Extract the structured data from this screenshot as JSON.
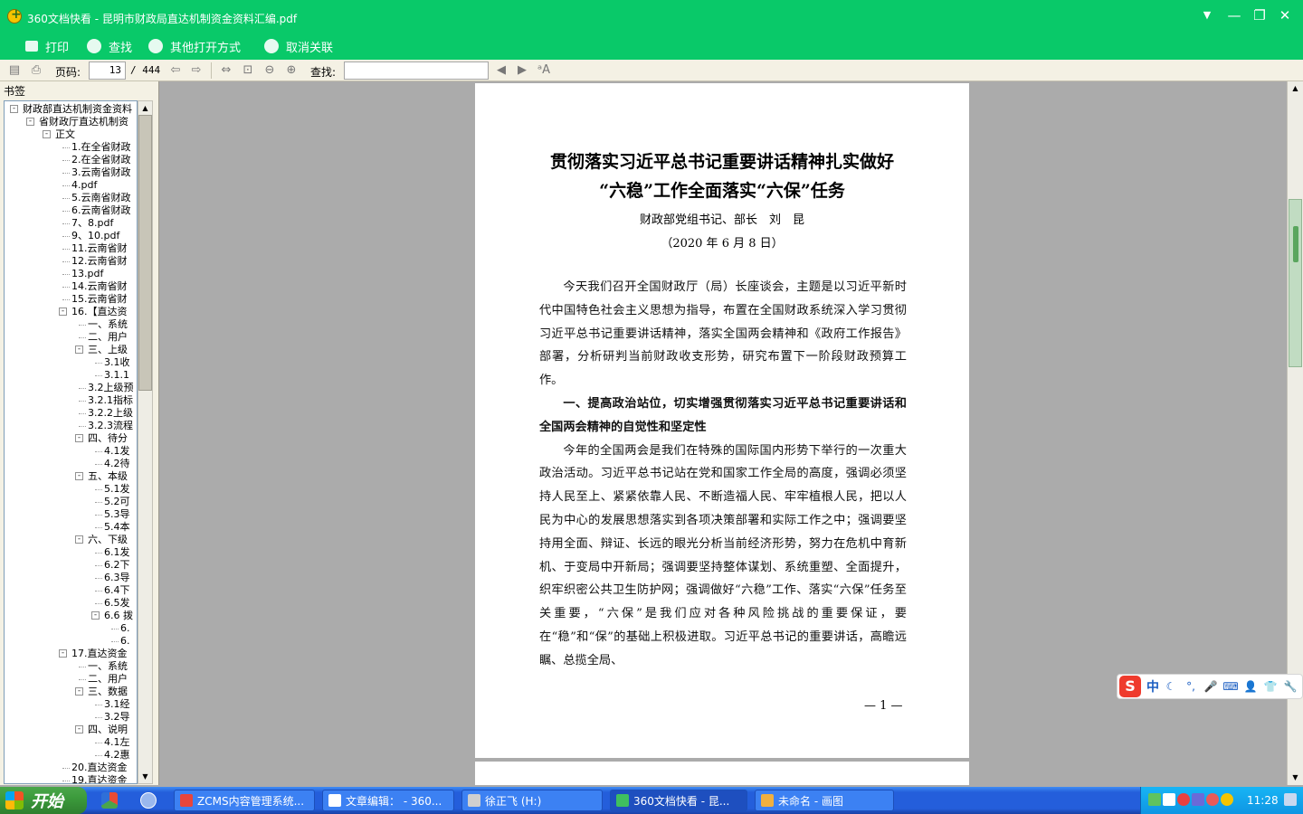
{
  "window": {
    "title": "360文档快看 - 昆明市财政局直达机制资金资料汇编.pdf",
    "minimize_glyph": "—",
    "maximize_glyph": "❐",
    "close_glyph": "✕",
    "menu_glyph": "▼"
  },
  "menu": {
    "print": "打印",
    "find": "查找",
    "open_with": "其他打开方式",
    "unassociate": "取消关联"
  },
  "toolbar": {
    "page_label": "页码:",
    "page_value": "13",
    "page_total": "/ 444",
    "search_label": "查找:",
    "search_value": ""
  },
  "sidebar": {
    "title": "书签",
    "items": [
      {
        "label": "财政部直达机制资金资料",
        "level": 0,
        "toggle": "-"
      },
      {
        "label": "省财政厅直达机制资",
        "level": 1,
        "toggle": "-"
      },
      {
        "label": "正文",
        "level": 2,
        "toggle": "-"
      },
      {
        "label": "1.在全省财政",
        "level": 3
      },
      {
        "label": "2.在全省财政",
        "level": 3
      },
      {
        "label": "3.云南省财政",
        "level": 3
      },
      {
        "label": "4.pdf",
        "level": 3
      },
      {
        "label": "5.云南省财政",
        "level": 3
      },
      {
        "label": "6.云南省财政",
        "level": 3
      },
      {
        "label": "7、8.pdf",
        "level": 3
      },
      {
        "label": "9、10.pdf",
        "level": 3
      },
      {
        "label": "11.云南省财",
        "level": 3
      },
      {
        "label": "12.云南省财",
        "level": 3
      },
      {
        "label": "13.pdf",
        "level": 3
      },
      {
        "label": "14.云南省财",
        "level": 3
      },
      {
        "label": "15.云南省财",
        "level": 3
      },
      {
        "label": "16.【直达资",
        "level": 3,
        "toggle": "-"
      },
      {
        "label": "一、系统",
        "level": 4
      },
      {
        "label": "二、用户",
        "level": 4
      },
      {
        "label": "三、上级",
        "level": 4,
        "toggle": "-"
      },
      {
        "label": "3.1收",
        "level": 5
      },
      {
        "label": "3.1.1",
        "level": 5
      },
      {
        "label": "3.2上级预",
        "level": 4
      },
      {
        "label": "3.2.1指标",
        "level": 4
      },
      {
        "label": "3.2.2上级",
        "level": 4
      },
      {
        "label": "3.2.3流程",
        "level": 4
      },
      {
        "label": "四、待分",
        "level": 4,
        "toggle": "-"
      },
      {
        "label": "4.1发",
        "level": 5
      },
      {
        "label": "4.2待",
        "level": 5
      },
      {
        "label": "五、本级",
        "level": 4,
        "toggle": "-"
      },
      {
        "label": "5.1发",
        "level": 5
      },
      {
        "label": "5.2可",
        "level": 5
      },
      {
        "label": "5.3导",
        "level": 5
      },
      {
        "label": "5.4本",
        "level": 5
      },
      {
        "label": "六、下级",
        "level": 4,
        "toggle": "-"
      },
      {
        "label": "6.1发",
        "level": 5
      },
      {
        "label": "6.2下",
        "level": 5
      },
      {
        "label": "6.3导",
        "level": 5
      },
      {
        "label": "6.4下",
        "level": 5
      },
      {
        "label": "6.5发",
        "level": 5
      },
      {
        "label": "6.6 拨",
        "level": 5,
        "toggle": "-"
      },
      {
        "label": "6.",
        "level": 6
      },
      {
        "label": "6.",
        "level": 6
      },
      {
        "label": "17.直达资金",
        "level": 3,
        "toggle": "-"
      },
      {
        "label": "一、系统",
        "level": 4
      },
      {
        "label": "二、用户",
        "level": 4
      },
      {
        "label": "三、数据",
        "level": 4,
        "toggle": "-"
      },
      {
        "label": "3.1经",
        "level": 5
      },
      {
        "label": "3.2导",
        "level": 5
      },
      {
        "label": "四、说明",
        "level": 4,
        "toggle": "-"
      },
      {
        "label": "4.1左",
        "level": 5
      },
      {
        "label": "4.2惠",
        "level": 5
      },
      {
        "label": "20.直达资金",
        "level": 3
      },
      {
        "label": "19.直达资金",
        "level": 3
      }
    ]
  },
  "document": {
    "title_line1": "贯彻落实习近平总书记重要讲话精神扎实做好",
    "title_line2": "“六稳”工作全面落实“六保”任务",
    "author": "财政部党组书记、部长　刘　昆",
    "date": "（2020 年 6 月 8 日）",
    "paragraphs": [
      {
        "type": "text",
        "text": "今天我们召开全国财政厅（局）长座谈会，主题是以习近平新时代中国特色社会主义思想为指导，布置在全国财政系统深入学习贯彻习近平总书记重要讲话精神，落实全国两会精神和《政府工作报告》部署，分析研判当前财政收支形势，研究布置下一阶段财政预算工作。"
      },
      {
        "type": "heading",
        "text": "一、提高政治站位，切实增强贯彻落实习近平总书记重要讲话和全国两会精神的自觉性和坚定性"
      },
      {
        "type": "text",
        "text": "今年的全国两会是我们在特殊的国际国内形势下举行的一次重大政治活动。习近平总书记站在党和国家工作全局的高度，强调必须坚持人民至上、紧紧依靠人民、不断造福人民、牢牢植根人民，把以人民为中心的发展思想落实到各项决策部署和实际工作之中；强调要坚持用全面、辩证、长远的眼光分析当前经济形势，努力在危机中育新机、于变局中开新局；强调要坚持整体谋划、系统重塑、全面提升，织牢织密公共卫生防护网；强调做好“六稳”工作、落实“六保”任务至关重要，“六保”是我们应对各种风险挑战的重要保证，要在“稳”和“保”的基础上积极进取。习近平总书记的重要讲话，高瞻远瞩、总揽全局、"
      }
    ],
    "page_number": "— 1 —"
  },
  "ime": {
    "logo": "S",
    "lang": "中",
    "icons": [
      "☾",
      "°,",
      "🎤",
      "⌨",
      "👤",
      "👕",
      "🔧"
    ]
  },
  "taskbar": {
    "start_label": "开始",
    "tasks": [
      {
        "label": "ZCMS内容管理系统...",
        "icon_color": "#e8453c"
      },
      {
        "label": "文章编辑： - 360...",
        "icon_color": "#ffffff"
      },
      {
        "label": "徐正飞 (H:)",
        "icon_color": "#cfcfcf"
      },
      {
        "label": "360文档快看 - 昆...",
        "icon_color": "#3fbf5f"
      },
      {
        "label": "未命名 - 画图",
        "icon_color": "#f0b040"
      }
    ],
    "clock": "11:28"
  }
}
